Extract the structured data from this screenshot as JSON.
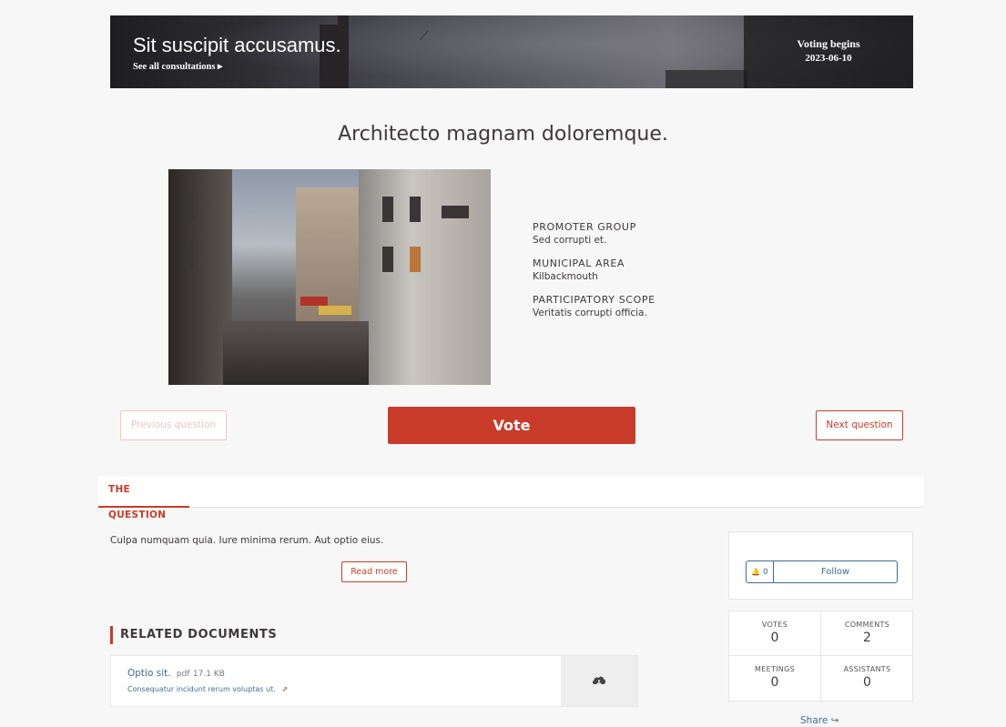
{
  "hero": {
    "title": "Sit suscipit accusamus.",
    "link_label": "See all consultations ▸",
    "status_label": "Voting begins",
    "status_date": "2023-06-10"
  },
  "question": {
    "title": "Architecto magnam doloremque."
  },
  "meta": [
    {
      "label": "PROMOTER GROUP",
      "value": "Sed corrupti et."
    },
    {
      "label": "MUNICIPAL AREA",
      "value": "Kilbackmouth"
    },
    {
      "label": "PARTICIPATORY SCOPE",
      "value": "Veritatis corrupti officia."
    }
  ],
  "nav": {
    "previous_label": "Previous question",
    "vote_label": "Vote",
    "next_label": "Next question"
  },
  "tabs": [
    {
      "label": "THE QUESTION",
      "active": true
    }
  ],
  "body": {
    "description": "Culpa numquam quia. Iure minima rerum. Aut optio eius.",
    "read_more_label": "Read more"
  },
  "related_documents": {
    "title": "RELATED DOCUMENTS",
    "items": [
      {
        "name": "Optio sit.",
        "type": "pdf",
        "size": "17.1 KB",
        "description": "Consequatur incidunt rerum voluptas ut.",
        "link_glyph": "⇗",
        "download_icon": "cloud-download-icon"
      }
    ]
  },
  "follow": {
    "count": "0",
    "label": "Follow",
    "bell_glyph": "🔔"
  },
  "stats": [
    {
      "label": "VOTES",
      "value": "0"
    },
    {
      "label": "COMMENTS",
      "value": "2"
    },
    {
      "label": "MEETINGS",
      "value": "0"
    },
    {
      "label": "ASSISTANTS",
      "value": "0"
    }
  ],
  "share": {
    "label": "Share",
    "glyph": "↪"
  },
  "colors": {
    "accent": "#c93c2a",
    "link": "#3e6e8f",
    "background": "#f7f7f7"
  }
}
